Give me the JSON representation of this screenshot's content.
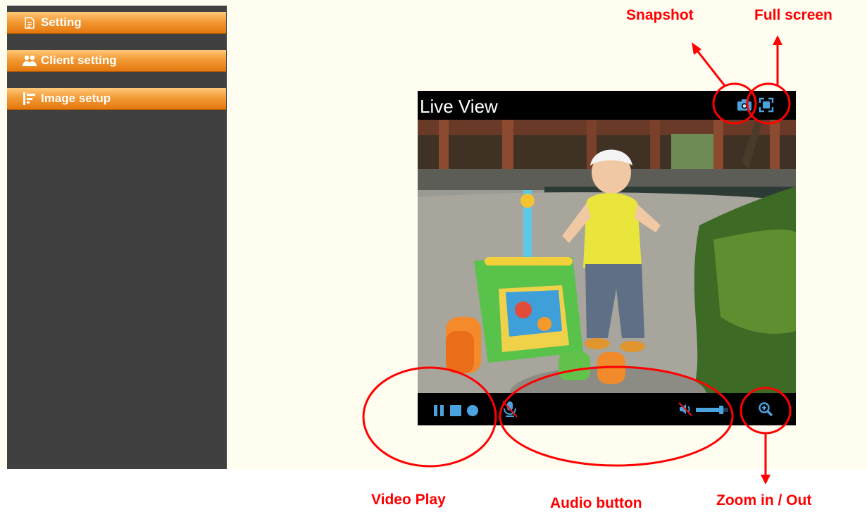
{
  "sidebar": {
    "items": [
      {
        "label": "Setting",
        "icon": "document-icon"
      },
      {
        "label": "Client setting",
        "icon": "users-icon"
      },
      {
        "label": "Image setup",
        "icon": "image-setup-icon"
      }
    ]
  },
  "viewer": {
    "title": "Live View",
    "top_controls": [
      "camera-icon",
      "fullscreen-icon"
    ],
    "bottom_controls": [
      "pause-icon",
      "stop-icon",
      "record-icon",
      "microphone-muted-icon",
      "speaker-muted-icon",
      "volume-slider",
      "zoom-in-icon"
    ],
    "volume_level": 0.85,
    "accent_color": "#4aa3df"
  },
  "annotations": {
    "snapshot": "Snapshot",
    "full_screen": "Full screen",
    "video_play": "Video Play",
    "audio_button": "Audio button",
    "zoom": "Zoom in / Out",
    "color": "#ff0000"
  }
}
